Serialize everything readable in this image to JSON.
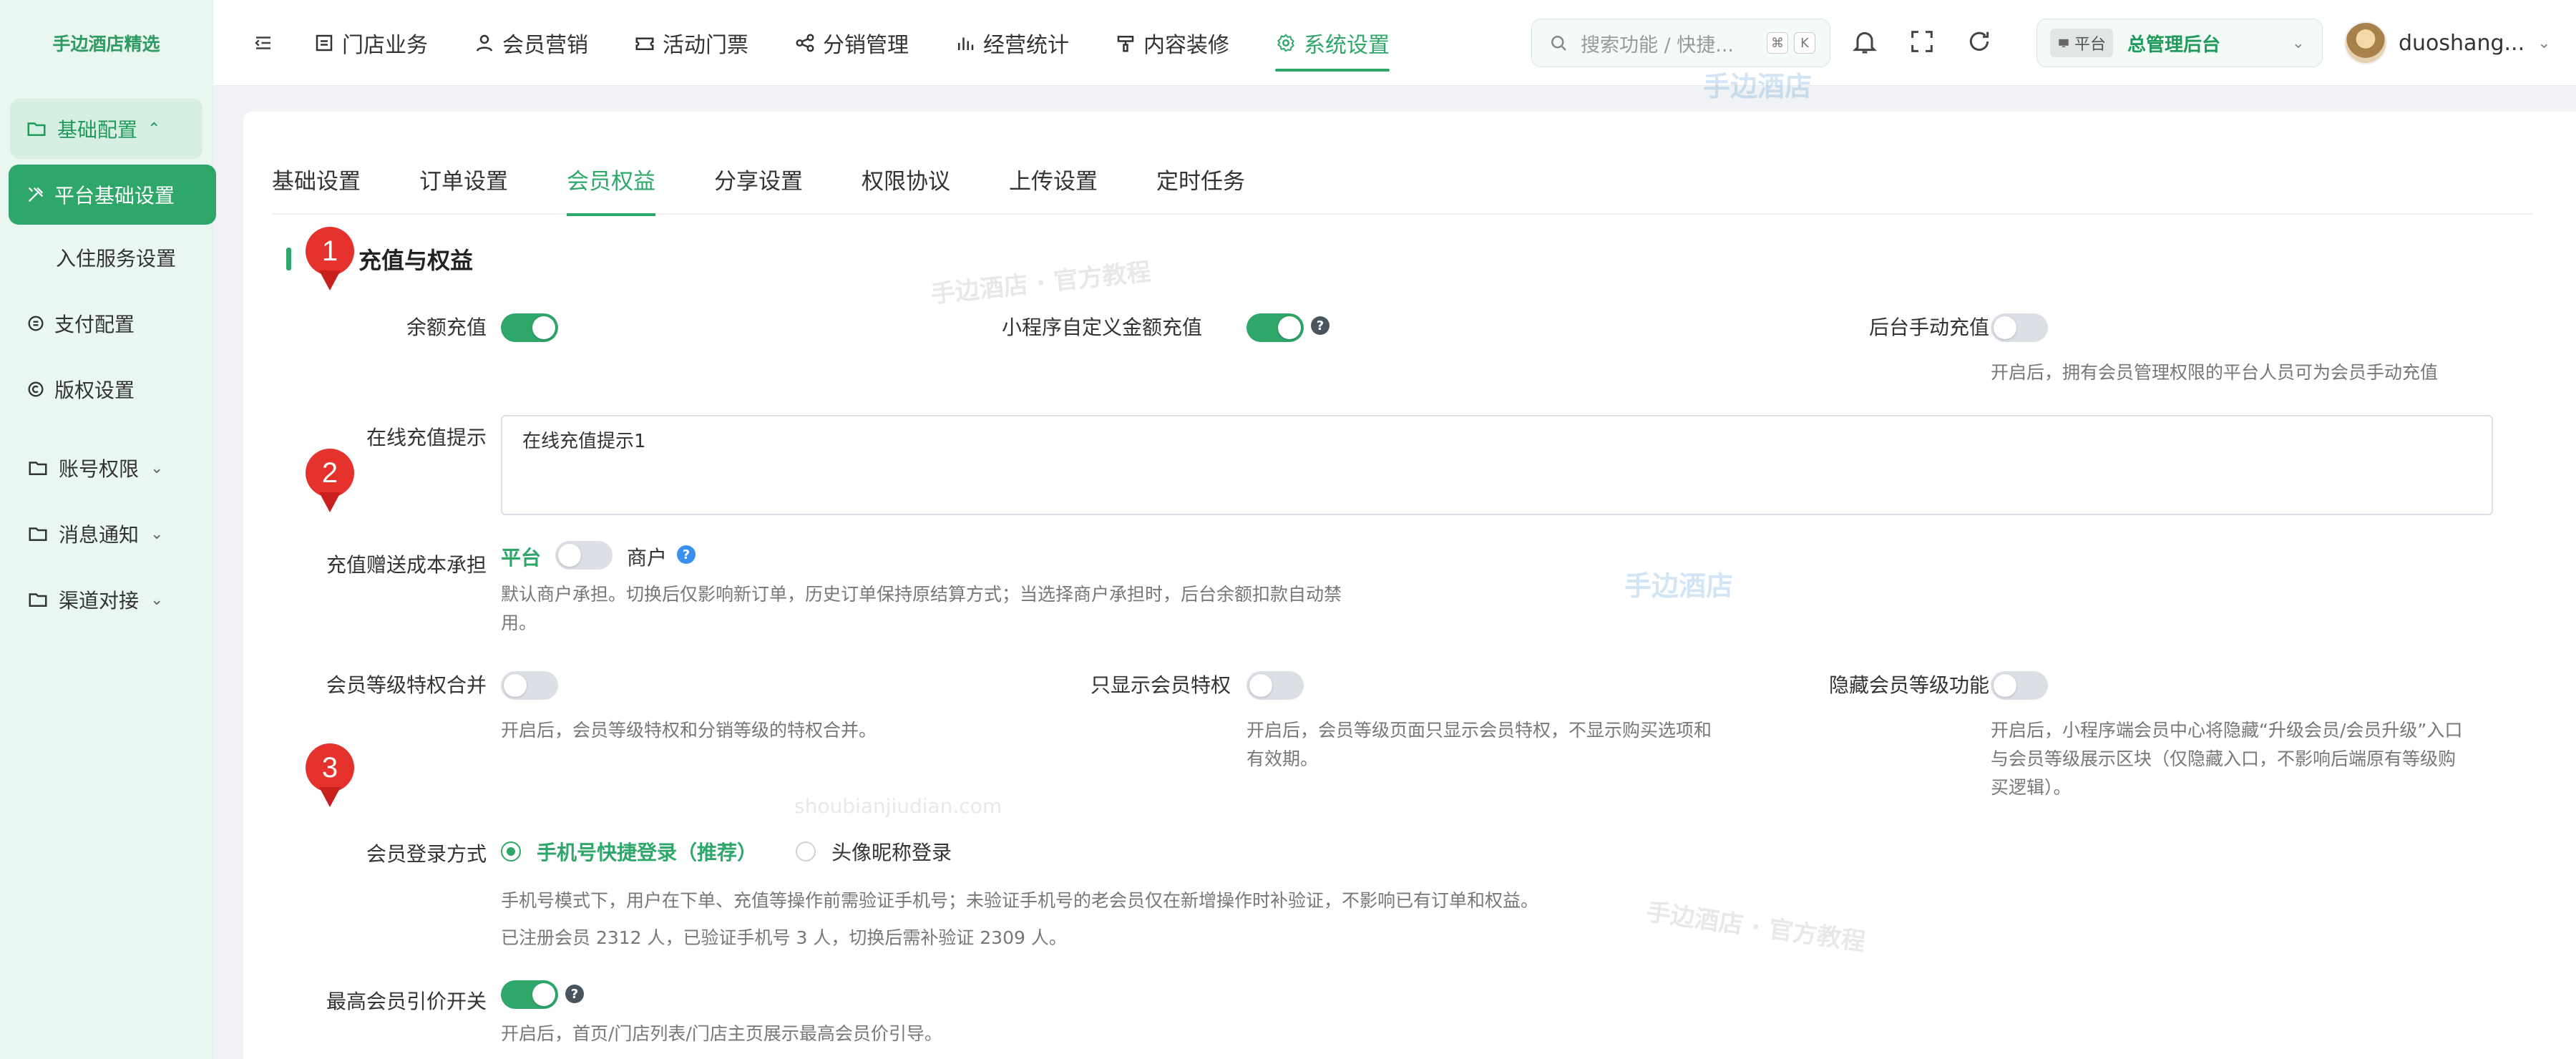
{
  "sidebar": {
    "brand": "手边酒店精选",
    "group_label": "基础配置",
    "items": [
      {
        "label": "平台基础设置"
      },
      {
        "label": "入住服务设置"
      },
      {
        "label": "支付配置"
      },
      {
        "label": "版权设置"
      }
    ],
    "groups": [
      {
        "label": "账号权限"
      },
      {
        "label": "消息通知"
      },
      {
        "label": "渠道对接"
      }
    ]
  },
  "topnav": {
    "items": [
      {
        "label": "门店业务"
      },
      {
        "label": "会员营销"
      },
      {
        "label": "活动门票"
      },
      {
        "label": "分销管理"
      },
      {
        "label": "经营统计"
      },
      {
        "label": "内容装修"
      },
      {
        "label": "系统设置"
      }
    ],
    "active_index": 6,
    "search_placeholder": "搜索功能 / 快捷...",
    "kbd_cmd": "⌘",
    "kbd_k": "K",
    "role_tag": "平台",
    "role_name": "总管理后台",
    "username": "duoshang..."
  },
  "tabs": [
    {
      "label": "基础设置"
    },
    {
      "label": "订单设置"
    },
    {
      "label": "会员权益"
    },
    {
      "label": "分享设置"
    },
    {
      "label": "权限协议"
    },
    {
      "label": "上传设置"
    },
    {
      "label": "定时任务"
    }
  ],
  "active_tab": 2,
  "section": {
    "title": "、充值与权益"
  },
  "fields": {
    "balance_recharge": {
      "label": "余额充值",
      "on": true
    },
    "miniapp_custom_recharge": {
      "label": "小程序自定义金额充值",
      "on": true
    },
    "manual_recharge": {
      "label": "后台手动充值",
      "on": false,
      "help": "开启后，拥有会员管理权限的平台人员可为会员手动充值"
    },
    "online_tip": {
      "label": "在线充值提示",
      "value": "在线充值提示1"
    },
    "cost_bearer": {
      "label": "充值赠送成本承担",
      "left": "平台",
      "right": "商户",
      "on": false,
      "help_line1": "默认商户承担。切换后仅影响新订单，历史订单保持原结算方式；当选择商户承担时，后台余额扣款自动禁",
      "help_line2": "用。"
    },
    "level_merge": {
      "label": "会员等级特权合并",
      "on": false,
      "help": "开启后，会员等级特权和分销等级的特权合并。"
    },
    "only_member_priv": {
      "label": "只显示会员特权",
      "on": false,
      "help_line1": "开启后，会员等级页面只显示会员特权，不显示购买选项和",
      "help_line2": "有效期。"
    },
    "hide_level": {
      "label": "隐藏会员等级功能",
      "on": false,
      "help_line1": "开启后，小程序端会员中心将隐藏“升级会员/会员升级”入口",
      "help_line2": "与会员等级展示区块（仅隐藏入口，不影响后端原有等级购",
      "help_line3": "买逻辑）。"
    },
    "login_method": {
      "label": "会员登录方式",
      "options": [
        "手机号快捷登录（推荐）",
        "头像昵称登录"
      ],
      "selected": 0,
      "help_line1": "手机号模式下，用户在下单、充值等操作前需验证手机号；未验证手机号的老会员仅在新增操作时补验证，不影响已有订单和权益。",
      "help_line2": "已注册会员 2312 人，已验证手机号 3 人，切换后需补验证 2309 人。"
    },
    "top_member_price": {
      "label": "最高会员引价开关",
      "on": true,
      "help": "开启后，首页/门店列表/门店主页展示最高会员价引导。"
    }
  },
  "markers": [
    "1",
    "2",
    "3"
  ],
  "watermarks": [
    "手边酒店",
    "手边酒店 · 官方教程",
    "手边酒店",
    "shoubianjiudian.com",
    "手边酒店 · 官方教程"
  ],
  "colors": {
    "accent": "#2fa66a",
    "marker": "#e5322d"
  }
}
